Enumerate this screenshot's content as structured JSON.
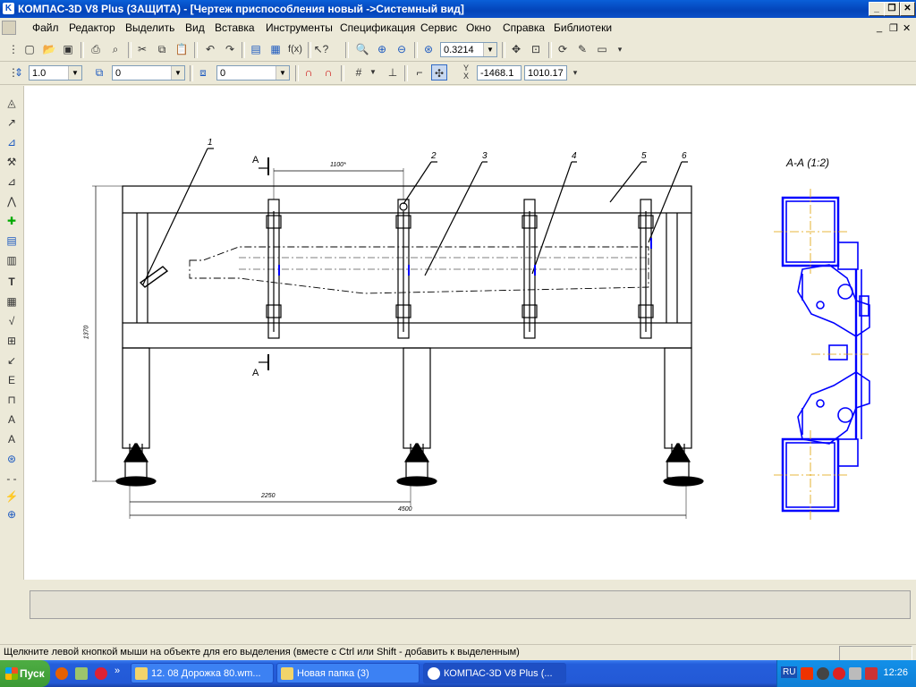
{
  "window": {
    "title": "КОМПАС-3D V8 Plus (ЗАЩИТА) - [Чертеж приспособления новый ->Системный вид]",
    "btn_minimize": "_",
    "btn_restore": "❐",
    "btn_close": "✕"
  },
  "menu": {
    "items": [
      "Файл",
      "Редактор",
      "Выделить",
      "Вид",
      "Вставка",
      "Инструменты",
      "Спецификация",
      "Сервис",
      "Окно",
      "Справка",
      "Библиотеки"
    ],
    "mdi_minimize": "_",
    "mdi_restore": "❐",
    "mdi_close": "✕"
  },
  "toolbar1": {
    "zoom_value": "0.3214"
  },
  "toolbar2": {
    "scale_value": "1.0",
    "layer_value": "0",
    "style_value": "0",
    "x_coord": "-1468.1",
    "y_coord": "1010.17"
  },
  "drawing": {
    "callouts": [
      "1",
      "2",
      "3",
      "4",
      "5",
      "6"
    ],
    "section_marker": "А",
    "section_title": "А-А (1:2)",
    "dim_top": "1100*",
    "dim_height": "1370",
    "dim_span": "2250",
    "dim_total": "4500"
  },
  "statusbar": {
    "message": "Щелкните левой кнопкой мыши на объекте для его выделения (вместе с Ctrl или Shift - добавить к выделенным)"
  },
  "taskbar": {
    "start_label": "Пуск",
    "tasks": [
      "12. 08 Дорожка 80.wm...",
      "Новая папка (3)",
      "КОМПАС-3D V8 Plus (..."
    ],
    "lang": "RU",
    "clock": "12:26"
  },
  "colors": {
    "drawing_line": "#000000",
    "section_blue": "#0000ff",
    "axis_orange": "#e0a000"
  }
}
